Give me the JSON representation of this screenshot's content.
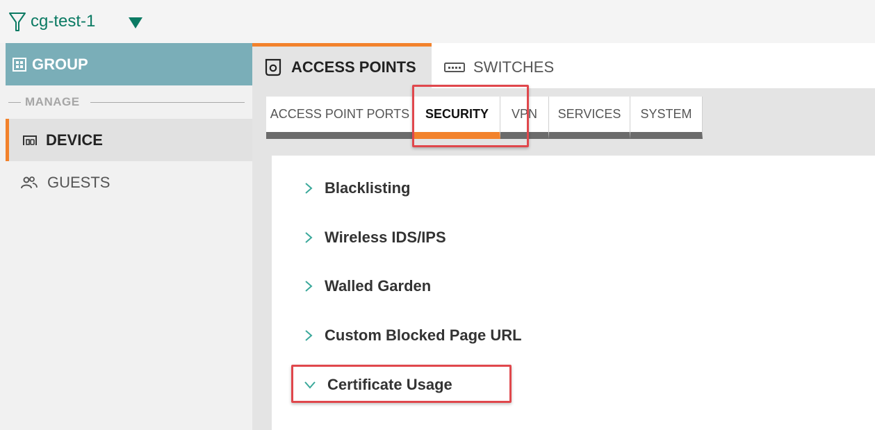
{
  "topbar": {
    "group_name": "cg-test-1",
    "accent_color": "#0b7a63"
  },
  "sidebar": {
    "group_label": "GROUP",
    "section_label": "MANAGE",
    "items": [
      {
        "label": "DEVICE",
        "icon": "device-icon",
        "selected": true
      },
      {
        "label": "GUESTS",
        "icon": "guests-icon",
        "selected": false
      }
    ],
    "header_color": "#7aaeb8"
  },
  "main": {
    "tabs": [
      {
        "label": "ACCESS POINTS",
        "icon": "access-point-icon",
        "active": true
      },
      {
        "label": "SWITCHES",
        "icon": "switch-icon",
        "active": false
      }
    ],
    "subtabs": [
      {
        "label": "ACCESS POINT PORTS",
        "active": false
      },
      {
        "label": "SECURITY",
        "active": true
      },
      {
        "label": "VPN",
        "active": false
      },
      {
        "label": "SERVICES",
        "active": false
      },
      {
        "label": "SYSTEM",
        "active": false
      }
    ],
    "sections": [
      {
        "label": "Blacklisting",
        "expanded": false
      },
      {
        "label": "Wireless IDS/IPS",
        "expanded": false
      },
      {
        "label": "Walled Garden",
        "expanded": false
      },
      {
        "label": "Custom Blocked Page URL",
        "expanded": false
      },
      {
        "label": "Certificate Usage",
        "expanded": true
      }
    ]
  },
  "colors": {
    "active_accent": "#f2822c",
    "highlight": "#e0474c",
    "chevron": "#3aa89a"
  }
}
